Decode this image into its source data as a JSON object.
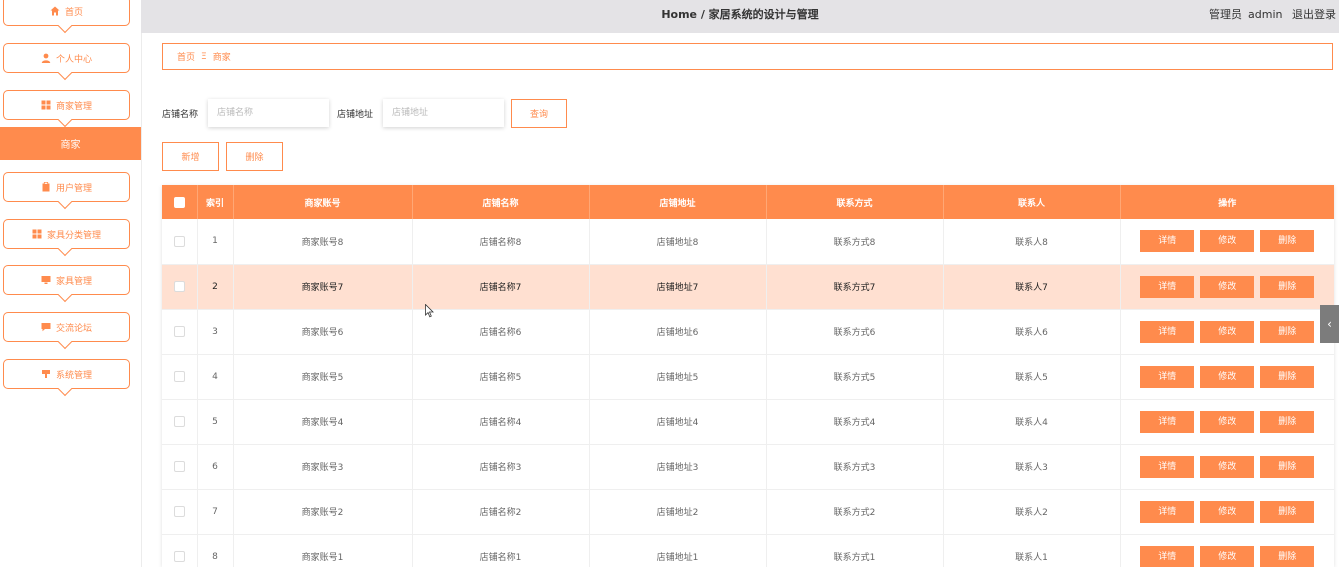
{
  "header": {
    "title": "Home / 家居系统的设计与管理",
    "role": "管理员",
    "username": "admin",
    "logout": "退出登录"
  },
  "sidebar": {
    "items": [
      {
        "label": "首页",
        "icon": "home-icon"
      },
      {
        "label": "个人中心",
        "icon": "user-icon"
      },
      {
        "label": "商家管理",
        "icon": "grid-icon"
      },
      {
        "label": "用户管理",
        "icon": "clipboard-icon"
      },
      {
        "label": "家具分类管理",
        "icon": "grid-icon"
      },
      {
        "label": "家具管理",
        "icon": "monitor-icon"
      },
      {
        "label": "交流论坛",
        "icon": "chat-icon"
      },
      {
        "label": "系统管理",
        "icon": "settings-icon"
      }
    ],
    "active_sub": "商家"
  },
  "breadcrumb": {
    "home": "首页",
    "separator": "Ξ",
    "current": "商家"
  },
  "search": {
    "shop_name_label": "店铺名称",
    "shop_name_placeholder": "店铺名称",
    "shop_addr_label": "店铺地址",
    "shop_addr_placeholder": "店铺地址",
    "query_button": "查询"
  },
  "toolbar": {
    "add_label": "新增",
    "delete_label": "删除"
  },
  "table": {
    "columns": [
      "索引",
      "商家账号",
      "店铺名称",
      "店铺地址",
      "联系方式",
      "联系人",
      "操作"
    ],
    "actions": {
      "detail": "详情",
      "edit": "修改",
      "delete": "删除"
    },
    "rows": [
      {
        "index": "1",
        "account": "商家账号8",
        "shop_name": "店铺名称8",
        "shop_addr": "店铺地址8",
        "contact": "联系方式8",
        "person": "联系人8"
      },
      {
        "index": "2",
        "account": "商家账号7",
        "shop_name": "店铺名称7",
        "shop_addr": "店铺地址7",
        "contact": "联系方式7",
        "person": "联系人7"
      },
      {
        "index": "3",
        "account": "商家账号6",
        "shop_name": "店铺名称6",
        "shop_addr": "店铺地址6",
        "contact": "联系方式6",
        "person": "联系人6"
      },
      {
        "index": "4",
        "account": "商家账号5",
        "shop_name": "店铺名称5",
        "shop_addr": "店铺地址5",
        "contact": "联系方式5",
        "person": "联系人5"
      },
      {
        "index": "5",
        "account": "商家账号4",
        "shop_name": "店铺名称4",
        "shop_addr": "店铺地址4",
        "contact": "联系方式4",
        "person": "联系人4"
      },
      {
        "index": "6",
        "account": "商家账号3",
        "shop_name": "店铺名称3",
        "shop_addr": "店铺地址3",
        "contact": "联系方式3",
        "person": "联系人3"
      },
      {
        "index": "7",
        "account": "商家账号2",
        "shop_name": "店铺名称2",
        "shop_addr": "店铺地址2",
        "contact": "联系方式2",
        "person": "联系人2"
      },
      {
        "index": "8",
        "account": "商家账号1",
        "shop_name": "店铺名称1",
        "shop_addr": "店铺地址1",
        "contact": "联系方式1",
        "person": "联系人1"
      }
    ]
  },
  "edge_toggle": "‹",
  "theme": {
    "accent": "#ff8b4d",
    "highlight_row": "#ffe0d1",
    "header_bg": "#e4e3e6"
  }
}
